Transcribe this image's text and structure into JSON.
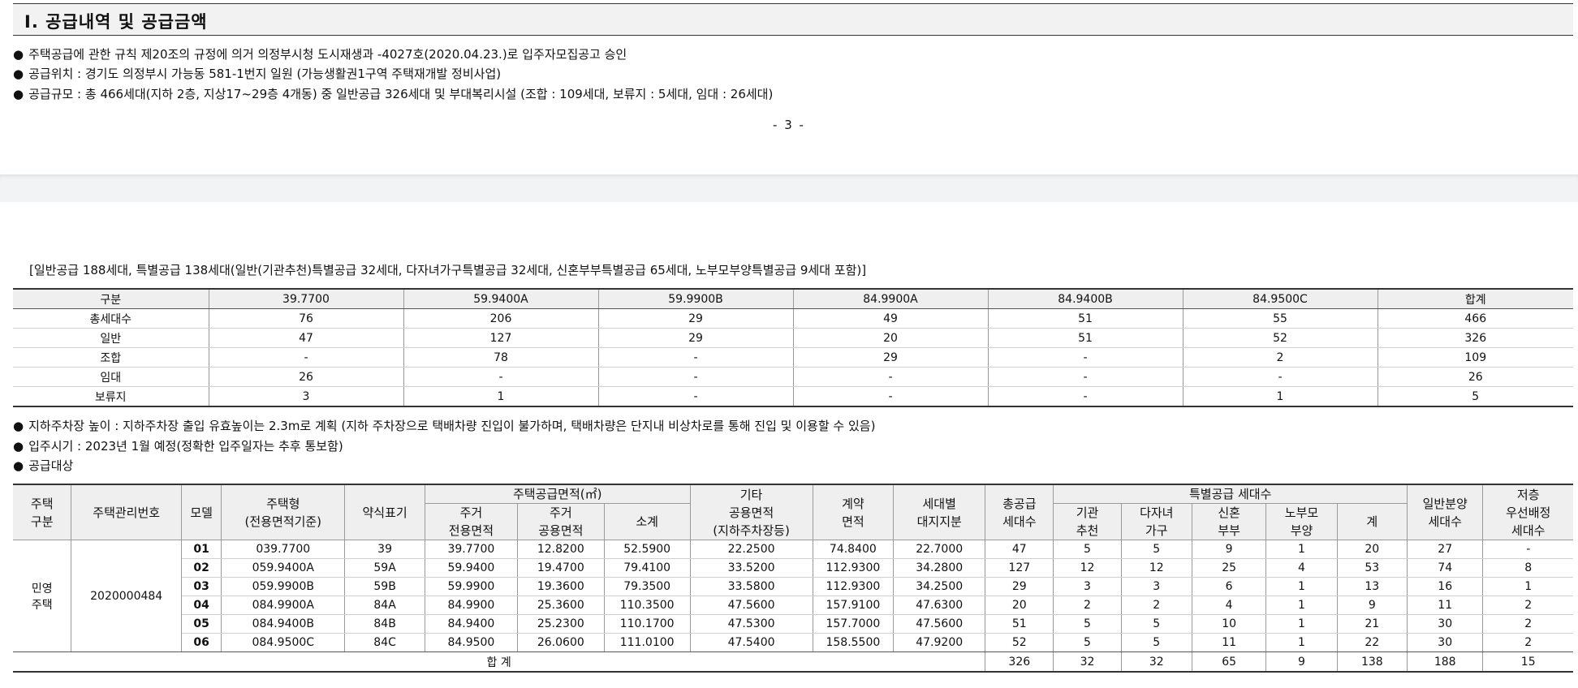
{
  "section": {
    "title": "Ⅰ. 공급내역 및 공급금액"
  },
  "bullet_symbol": "●",
  "bullets_top": [
    "주택공급에 관한 규칙 제20조의 규정에 의거 의정부시청 도시재생과 -4027호(2020.04.23.)로 입주자모집공고 승인",
    "공급위치 : 경기도 의정부시 가능동 581-1번지 일원 (가능생활권1구역 주택재개발 정비사업)",
    "공급규모 : 총 466세대(지하 2층, 지상17~29층 4개동) 중 일반공급 326세대 및 부대복리시설 (조합 : 109세대, 보류지 : 5세대, 임대 : 26세대)"
  ],
  "page_number": "- 3 -",
  "note": "[일반공급 188세대, 특별공급 138세대(일반(기관추천)특별공급 32세대, 다자녀가구특별공급 32세대, 신혼부부특별공급 65세대, 노부모부양특별공급 9세대 포함)]",
  "summary_table": {
    "headers": [
      "구분",
      "39.7700",
      "59.9400A",
      "59.9900B",
      "84.9900A",
      "84.9400B",
      "84.9500C",
      "합계"
    ],
    "rows": [
      [
        "총세대수",
        "76",
        "206",
        "29",
        "49",
        "51",
        "55",
        "466"
      ],
      [
        "일반",
        "47",
        "127",
        "29",
        "20",
        "51",
        "52",
        "326"
      ],
      [
        "조합",
        "-",
        "78",
        "-",
        "29",
        "-",
        "2",
        "109"
      ],
      [
        "임대",
        "26",
        "-",
        "-",
        "-",
        "-",
        "-",
        "26"
      ],
      [
        "보류지",
        "3",
        "1",
        "-",
        "-",
        "-",
        "1",
        "5"
      ]
    ]
  },
  "bullets_bottom": [
    "지하주차장 높이 : 지하주차장 출입 유효높이는 2.3m로 계획 (지하 주차장으로 택배차량 진입이 불가하며, 택배차량은 단지내 비상차로를 통해 진입 및 이용할 수 있음)",
    "입주시기 : 2023년 1월 예정(정확한 입주일자는 추후 통보함)",
    "공급대상"
  ],
  "supply_table": {
    "h": {
      "type": "주택\n구분",
      "mgmt_no": "주택관리번호",
      "model": "모델",
      "house_type": "주택형\n(전용면적기준)",
      "abbr": "약식표기",
      "area_group": "주택공급면적(㎡)",
      "exclusive": "주거\n전용면적",
      "common": "주거\n공용면적",
      "subtotal": "소계",
      "other_common": "기타\n공용면적\n(지하주차장등)",
      "contract_area": "계약\n면적",
      "land_share": "세대별\n대지지분",
      "total_units": "총공급\n세대수",
      "special_group": "특별공급 세대수",
      "sp_inst": "기관\n추천",
      "sp_multi": "다자녀\n가구",
      "sp_newlywed": "신혼\n부부",
      "sp_elderly": "노부모\n부양",
      "sp_sum": "계",
      "general": "일반분양\n세대수",
      "low_floor": "저층\n우선배정\n세대수"
    },
    "house_type_label": "민영\n주택",
    "mgmt_number": "2020000484",
    "rows": [
      [
        "01",
        "039.7700",
        "39",
        "39.7700",
        "12.8200",
        "52.5900",
        "22.2500",
        "74.8400",
        "22.7000",
        "47",
        "5",
        "5",
        "9",
        "1",
        "20",
        "27",
        "-"
      ],
      [
        "02",
        "059.9400A",
        "59A",
        "59.9400",
        "19.4700",
        "79.4100",
        "33.5200",
        "112.9300",
        "34.2800",
        "127",
        "12",
        "12",
        "25",
        "4",
        "53",
        "74",
        "8"
      ],
      [
        "03",
        "059.9900B",
        "59B",
        "59.9900",
        "19.3600",
        "79.3500",
        "33.5800",
        "112.9300",
        "34.2500",
        "29",
        "3",
        "3",
        "6",
        "1",
        "13",
        "16",
        "1"
      ],
      [
        "04",
        "084.9900A",
        "84A",
        "84.9900",
        "25.3600",
        "110.3500",
        "47.5600",
        "157.9100",
        "47.6300",
        "20",
        "2",
        "2",
        "4",
        "1",
        "9",
        "11",
        "2"
      ],
      [
        "05",
        "084.9400B",
        "84B",
        "84.9400",
        "25.2300",
        "110.1700",
        "47.5300",
        "157.7000",
        "47.5600",
        "51",
        "5",
        "5",
        "10",
        "1",
        "21",
        "30",
        "2"
      ],
      [
        "06",
        "084.9500C",
        "84C",
        "84.9500",
        "26.0600",
        "111.0100",
        "47.5400",
        "158.5500",
        "47.9200",
        "52",
        "5",
        "5",
        "11",
        "1",
        "22",
        "30",
        "2"
      ]
    ],
    "total_label": "합 계",
    "totals": [
      "326",
      "32",
      "32",
      "65",
      "9",
      "138",
      "188",
      "15"
    ]
  }
}
